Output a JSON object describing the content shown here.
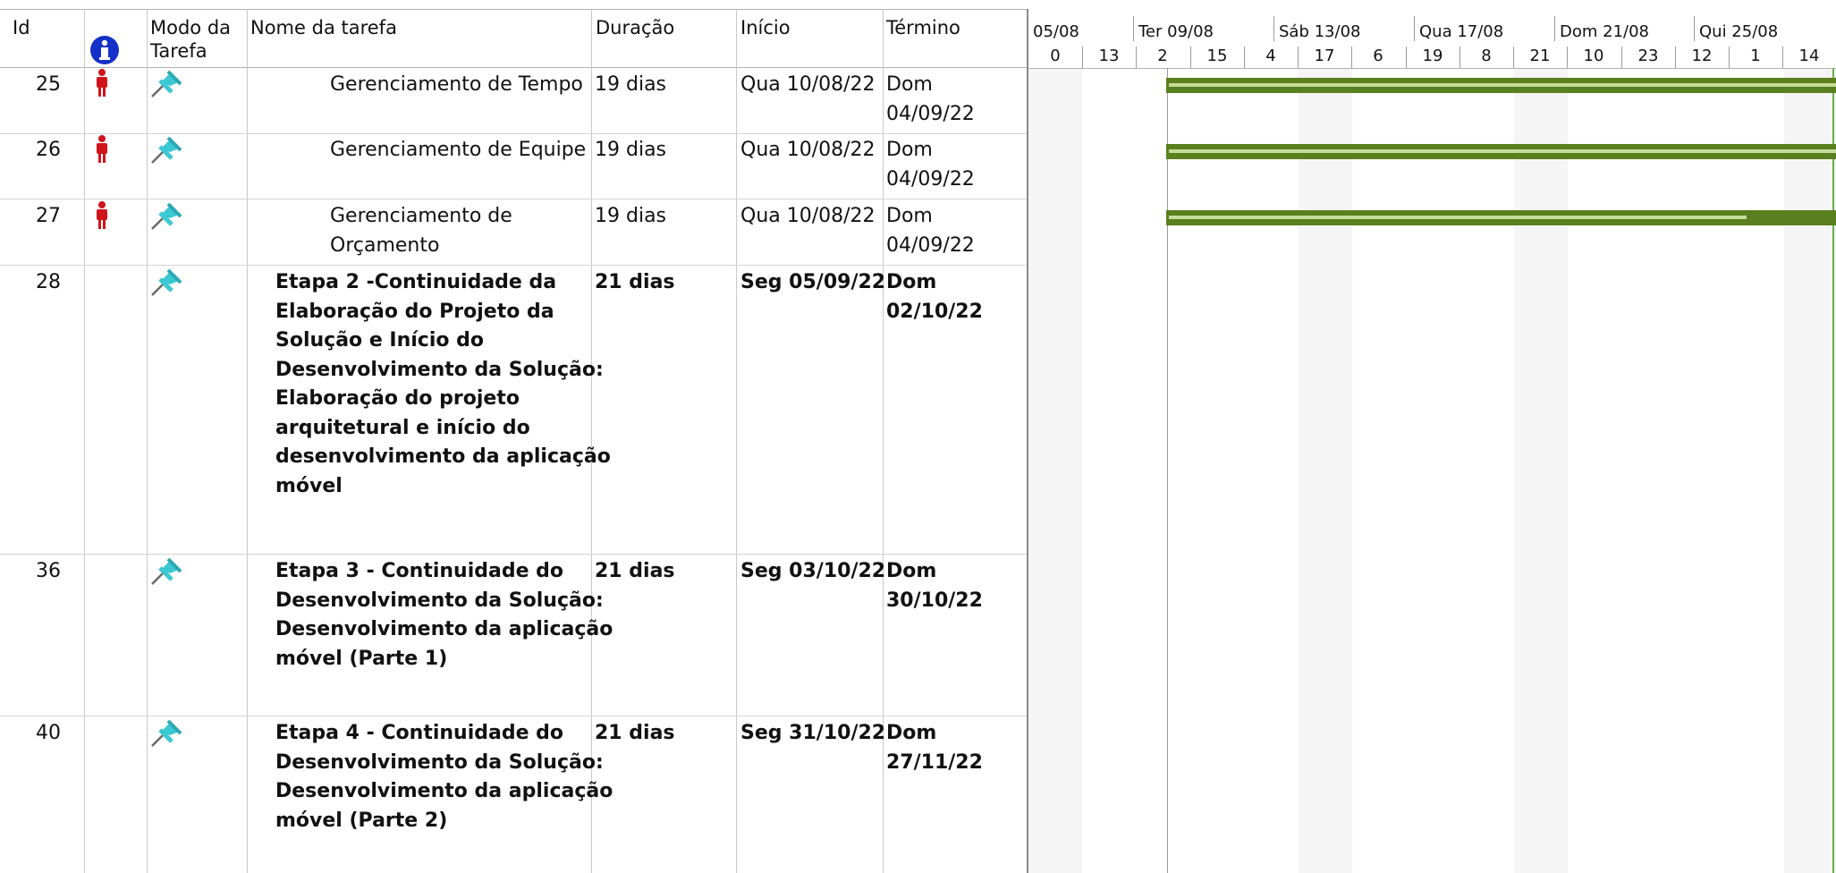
{
  "columns": {
    "id": "Id",
    "mode_line1": "Modo da",
    "mode_line2": "Tarefa",
    "name": "Nome da tarefa",
    "duration": "Duração",
    "start": "Início",
    "finish": "Término"
  },
  "timeline": {
    "top_labels": [
      "05/08",
      "Ter 09/08",
      "Sáb 13/08",
      "Qua 17/08",
      "Dom 21/08",
      "Qui 25/08"
    ],
    "bottom_labels": [
      "0",
      "13",
      "2",
      "15",
      "4",
      "17",
      "6",
      "19",
      "8",
      "21",
      "10",
      "23",
      "12",
      "1",
      "14"
    ]
  },
  "rows": [
    {
      "id": "25",
      "name": "Gerenciamento de Tempo",
      "duration": "19 dias",
      "start": "Qua 10/08/22",
      "finish_line1": "Dom",
      "finish_line2": "04/09/22",
      "summary": false,
      "progress": 1.0
    },
    {
      "id": "26",
      "name": "Gerenciamento de Equipe",
      "duration": "19 dias",
      "start": "Qua 10/08/22",
      "finish_line1": "Dom",
      "finish_line2": "04/09/22",
      "summary": false,
      "progress": 1.0
    },
    {
      "id": "27",
      "name_line1": "Gerenciamento de",
      "name_line2": "Orçamento",
      "duration": "19 dias",
      "start": "Qua 10/08/22",
      "finish_line1": "Dom",
      "finish_line2": "04/09/22",
      "summary": false,
      "progress": 0.87
    },
    {
      "id": "28",
      "name_lines": [
        "Etapa 2 -Continuidade da",
        "Elaboração do Projeto da",
        "Solução e Início do",
        "Desenvolvimento da Solução:",
        "Elaboração do projeto",
        "arquitetural e início do",
        "desenvolvimento da aplicação",
        "móvel"
      ],
      "duration": "21 dias",
      "start": "Seg 05/09/22",
      "finish_line1": "Dom",
      "finish_line2": "02/10/22",
      "summary": true
    },
    {
      "id": "36",
      "name_lines": [
        "Etapa 3 - Continuidade do",
        "Desenvolvimento da Solução:",
        "Desenvolvimento da aplicação",
        "móvel (Parte 1)"
      ],
      "duration": "21 dias",
      "start": "Seg 03/10/22",
      "finish_line1": "Dom",
      "finish_line2": "30/10/22",
      "summary": true
    },
    {
      "id": "40",
      "name_lines": [
        "Etapa 4 - Continuidade do",
        "Desenvolvimento da Solução:",
        "Desenvolvimento da aplicação",
        "móvel (Parte 2)"
      ],
      "duration": "21 dias",
      "start": "Seg 31/10/22",
      "finish_line1": "Dom",
      "finish_line2": "27/11/22",
      "summary": true
    }
  ],
  "colors": {
    "bar_dark": "#5a7f1e",
    "bar_light": "#c8dc9a",
    "weekend_shade": "#f5f5f5",
    "grid": "#c8c8c8",
    "info_icon": "#1530c8",
    "person_icon": "#d0141c",
    "pin_icon": "#3cc8d2"
  },
  "icons": {
    "info": "info-icon",
    "person": "resource-person-icon",
    "pin": "manual-schedule-pin-icon"
  }
}
